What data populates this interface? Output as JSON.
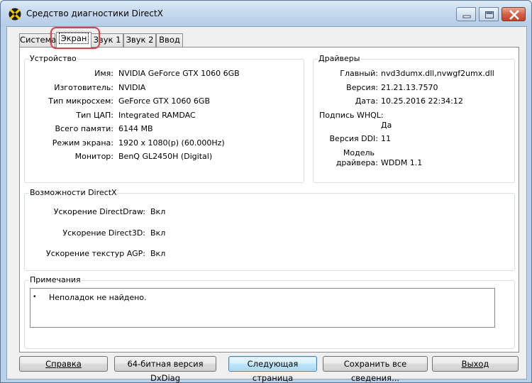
{
  "window": {
    "title": "Средство диагностики DirectX"
  },
  "tabs": [
    {
      "label": "Система",
      "active": false
    },
    {
      "label": "Экран",
      "active": true
    },
    {
      "label": "Звук 1",
      "active": false
    },
    {
      "label": "Звук 2",
      "active": false
    },
    {
      "label": "Ввод",
      "active": false
    }
  ],
  "device": {
    "title": "Устройство",
    "rows": [
      {
        "label": "Имя:",
        "value": "NVIDIA GeForce GTX 1060 6GB"
      },
      {
        "label": "Изготовитель:",
        "value": "NVIDIA"
      },
      {
        "label": "Тип микросхем:",
        "value": "GeForce GTX 1060 6GB"
      },
      {
        "label": "Тип ЦАП:",
        "value": "Integrated RAMDAC"
      },
      {
        "label": "Всего памяти:",
        "value": "6144 MB"
      },
      {
        "label": "Режим экрана:",
        "value": "1920 x 1080(p) (60.000Hz)"
      },
      {
        "label": "Монитор:",
        "value": "BenQ GL2450H (Digital)"
      }
    ]
  },
  "drivers": {
    "title": "Драйверы",
    "main_label": "Главный:",
    "main_value": "nvd3dumx.dll,nvwgf2umx.dll",
    "version_label": "Версия:",
    "version_value": "21.21.13.7570",
    "date_label": "Дата:",
    "date_value": "10.25.2016  22:34:12",
    "whql_label": "Подпись WHQL:",
    "whql_value": "Да",
    "ddi_label": "Версия DDI:",
    "ddi_value": "11",
    "model_label_1": "Модель",
    "model_label_2": "драйвера:",
    "model_value": "WDDM 1.1"
  },
  "directx": {
    "title": "Возможности DirectX",
    "rows": [
      {
        "label": "Ускорение DirectDraw:",
        "value": "Вкл"
      },
      {
        "label": "Ускорение Direct3D:",
        "value": "Вкл"
      },
      {
        "label": "Ускорение текстур AGP:",
        "value": "Вкл"
      }
    ]
  },
  "notes": {
    "title": "Примечания",
    "bullet": "•",
    "text": "Неполадок не найдено."
  },
  "buttons": {
    "help": "Справка",
    "dxdiag64": "64-битная версия DxDiag",
    "next_page": "Следующая страница",
    "save_all": "Сохранить все сведения...",
    "exit": "Выход"
  },
  "icons": {
    "app": "directx-logo-icon",
    "minimize": "minimize-icon",
    "maximize": "maximize-icon",
    "close": "close-icon"
  },
  "colors": {
    "highlight_ring": "#c8494f",
    "title_bar": "#c4d8ee",
    "close_button": "#c1432a"
  }
}
